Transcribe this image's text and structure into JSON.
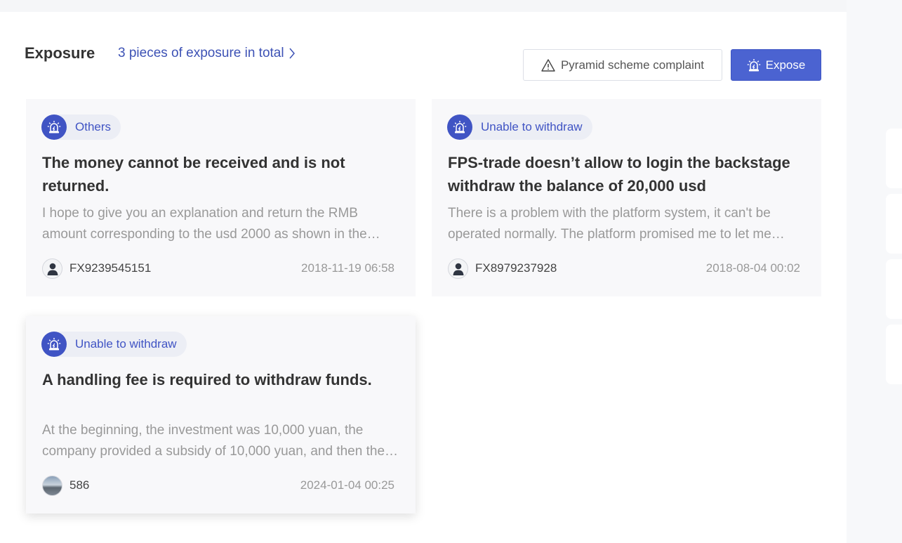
{
  "header": {
    "title": "Exposure",
    "total_link": "3 pieces of exposure in total",
    "pyramid_button": "Pyramid scheme complaint",
    "expose_button": "Expose"
  },
  "colors": {
    "accent": "#4b63d1",
    "badge_text": "#4054c4",
    "card_bg": "#f8f8fa"
  },
  "cards": [
    {
      "category": "Others",
      "title": "The money cannot be received and is not returned.",
      "description": "I hope to give you an explanation and return the RMB amount corresponding to the usd 2000 as shown in the screenshot.",
      "author": "FX9239545151",
      "date": "2018-11-19 06:58",
      "avatar": "default-user-icon"
    },
    {
      "category": "Unable to withdraw",
      "title": "FPS-trade doesn’t allow to login the backstage withdraw the balance of 20,000 usd",
      "description": "There is a problem with the platform system, it can't be operated normally. The platform promised me to let me withdraw the money.",
      "author": "FX8979237928",
      "date": "2018-08-04 00:02",
      "avatar": "default-user-icon"
    },
    {
      "category": "Unable to withdraw",
      "title": "A handling fee is required to withdraw funds.",
      "description": "At the beginning, the investment was 10,000 yuan, the company provided a subsidy of 10,000 yuan, and then the profit could not be withdrawn.",
      "author": "586",
      "date": "2024-01-04 00:25",
      "avatar": "photo-avatar"
    }
  ]
}
